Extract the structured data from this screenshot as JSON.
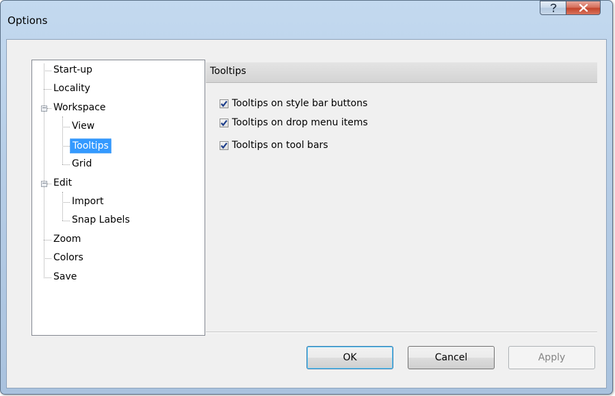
{
  "window": {
    "title": "Options"
  },
  "caption": {
    "help_glyph": "?",
    "close_glyph": "✕"
  },
  "tree": {
    "items": [
      {
        "label": "Start-up"
      },
      {
        "label": "Locality"
      },
      {
        "label": "Workspace",
        "expanded": true
      },
      {
        "label": "View"
      },
      {
        "label": "Tooltips",
        "selected": true
      },
      {
        "label": "Grid"
      },
      {
        "label": "Edit",
        "expanded": true
      },
      {
        "label": "Import"
      },
      {
        "label": "Snap Labels"
      },
      {
        "label": "Zoom"
      },
      {
        "label": "Colors"
      },
      {
        "label": "Save"
      }
    ],
    "expander_glyph": "−"
  },
  "panel": {
    "title": "Tooltips",
    "options": [
      {
        "label": "Tooltips on style bar buttons",
        "checked": true
      },
      {
        "label": "Tooltips on drop menu items",
        "checked": true
      },
      {
        "label": "Tooltips on tool bars",
        "checked": true
      }
    ]
  },
  "buttons": {
    "ok": "OK",
    "cancel": "Cancel",
    "apply": "Apply",
    "apply_enabled": false
  },
  "colors": {
    "selection": "#3399ff",
    "check": "#1c3d8a"
  }
}
